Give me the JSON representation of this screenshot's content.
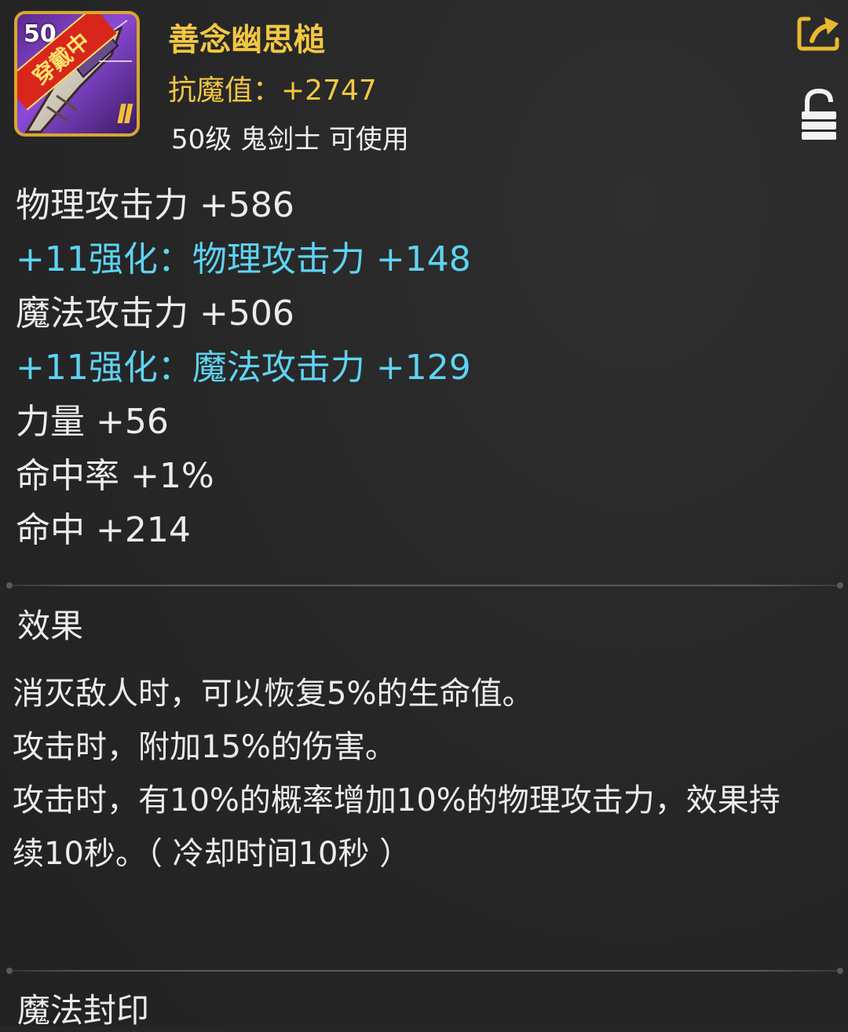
{
  "item": {
    "level_badge": "50",
    "equipped_label": "穿戴中",
    "grade_mark": "II",
    "name": "善念幽思槌",
    "anti_magic": "抗魔值：+2747",
    "requirement": "50级 鬼剑士 可使用"
  },
  "icons": {
    "share": "share-icon",
    "lock": "lock-icon"
  },
  "stats": [
    {
      "text": "物理攻击力 +586",
      "type": "base"
    },
    {
      "text": "+11强化：物理攻击力 +148",
      "type": "enhance"
    },
    {
      "text": "魔法攻击力 +506",
      "type": "base"
    },
    {
      "text": "+11强化：魔法攻击力 +129",
      "type": "enhance"
    },
    {
      "text": "力量 +56",
      "type": "base"
    },
    {
      "text": "命中率 +1%",
      "type": "base"
    },
    {
      "text": "命中 +214",
      "type": "base"
    }
  ],
  "effect": {
    "title": "效果",
    "lines": [
      "消灭敌人时，可以恢复5%的生命值。",
      "攻击时，附加15%的伤害。",
      "攻击时，有10%的概率增加10%的物理攻击力，效果持",
      "续10秒。（ 冷却时间10秒 ）"
    ]
  },
  "seal": {
    "title": "魔法封印"
  },
  "colors": {
    "background": "#262626",
    "item_name": "#f2c744",
    "enhance": "#5fd3f2",
    "text": "#ececec",
    "frame": "#d7a72f"
  }
}
